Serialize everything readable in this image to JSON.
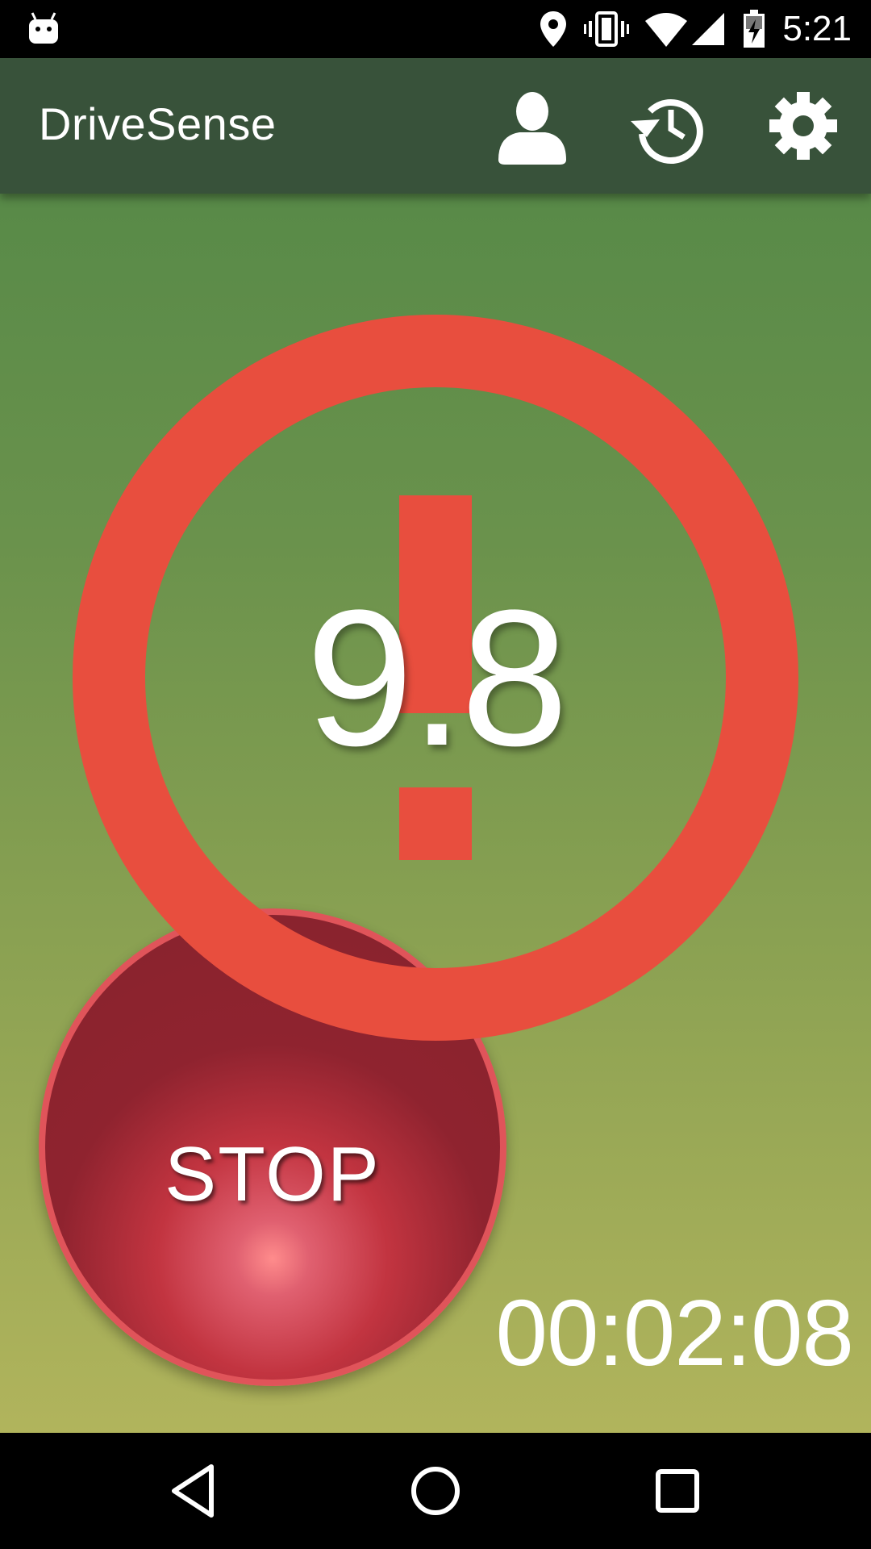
{
  "status_bar": {
    "time": "5:21",
    "icons": [
      "android-notification-icon",
      "location-icon",
      "vibrate-icon",
      "wifi-icon",
      "cell-signal-icon",
      "battery-charging-icon"
    ]
  },
  "app_bar": {
    "title": "DriveSense",
    "actions": [
      "profile-icon",
      "history-icon",
      "settings-icon"
    ]
  },
  "main": {
    "score": "9.8",
    "warning_icon": "exclamation-ring-icon",
    "stop_label": "STOP",
    "timer": "00:02:08"
  },
  "colors": {
    "app_bar": "#38523a",
    "warning": "#e84e3e",
    "stop_button": "#87232d",
    "gradient_top": "#588a48",
    "gradient_bottom": "#b1b45c"
  },
  "nav_bar": {
    "buttons": [
      "back-icon",
      "home-icon",
      "recents-icon"
    ]
  }
}
